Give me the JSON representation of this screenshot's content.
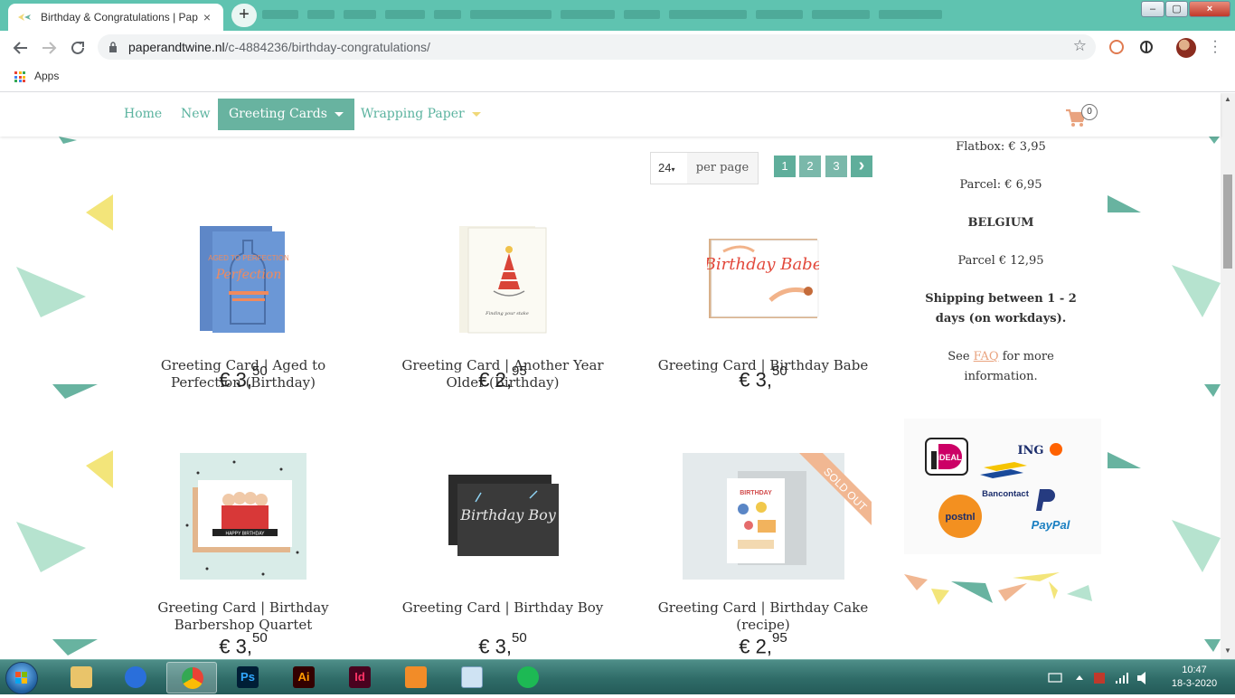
{
  "browser": {
    "tab_title": "Birthday & Congratulations | Pap",
    "tab_close": "×",
    "new_tab": "+",
    "url_host": "paperandtwine.nl",
    "url_path": "/c-4884236/birthday-congratulations/",
    "bookmark_apps": "Apps",
    "win_min": "–",
    "win_max": "▢",
    "win_close": "×"
  },
  "site_nav": {
    "items": [
      {
        "label": "Home"
      },
      {
        "label": "New"
      },
      {
        "label": "Greeting Cards"
      },
      {
        "label": "Wrapping Paper"
      }
    ],
    "cart_count": "0"
  },
  "pager": {
    "per_page_value": "24",
    "per_page_label": "per page",
    "pages": [
      "1",
      "2",
      "3"
    ],
    "current_page": "1",
    "next": "›"
  },
  "products": [
    {
      "name": "Greeting Card | Aged to Perfection (Birthday)",
      "price_main": "€ 3,",
      "price_cents": "50",
      "image_text": "AGED TO PERFECTION"
    },
    {
      "name": "Greeting Card | Another Year Older (Birthday)",
      "price_main": "€ 2,",
      "price_cents": "95",
      "image_text": "Finding your stake"
    },
    {
      "name": "Greeting Card | Birthday Babe",
      "price_main": "€ 3,",
      "price_cents": "50",
      "image_text": "Birthday Babe"
    },
    {
      "name": "Greeting Card | Birthday Barbershop Quartet",
      "price_main": "€ 3,",
      "price_cents": "50",
      "image_text": "HAPPY BIRTHDAY"
    },
    {
      "name": "Greeting Card | Birthday Boy",
      "price_main": "€ 3,",
      "price_cents": "50",
      "image_text": "Birthday Boy"
    },
    {
      "name": "Greeting Card | Birthday Cake (recipe)",
      "price_main": "€ 2,",
      "price_cents": "95",
      "image_text": "BIRTHDAY",
      "badge": "SOLD OUT"
    }
  ],
  "sidebar": {
    "flatbox": "Flatbox: € 3,95",
    "parcel_nl": "Parcel: € 6,95",
    "belgium": "BELGIUM",
    "parcel_be": "Parcel € 12,95",
    "shipping_line1": "Shipping between 1 - 2",
    "shipping_line2": "days (on workdays).",
    "see_before": "See ",
    "faq": "FAQ",
    "see_after": " for more",
    "information": "information."
  },
  "payments": {
    "ideal": "iDEAL",
    "ing": "ING",
    "bancontact": "Bancontact",
    "postnl": "postnl",
    "paypal": "PayPal"
  },
  "taskbar": {
    "apps": [
      {
        "name": "file-explorer",
        "label": ""
      },
      {
        "name": "thunderbird",
        "label": ""
      },
      {
        "name": "chrome",
        "label": ""
      },
      {
        "name": "photoshop",
        "label": "Ps"
      },
      {
        "name": "illustrator",
        "label": "Ai"
      },
      {
        "name": "indesign",
        "label": "Id"
      },
      {
        "name": "paint",
        "label": ""
      },
      {
        "name": "calculator",
        "label": ""
      },
      {
        "name": "spotify",
        "label": ""
      }
    ],
    "time": "10:47",
    "date": "18-3-2020"
  },
  "colors": {
    "brand_teal": "#68b3a0",
    "accent_peach": "#e9a37f",
    "accent_yellow": "#f0d879",
    "deco_mint": "#b6e3cf"
  }
}
